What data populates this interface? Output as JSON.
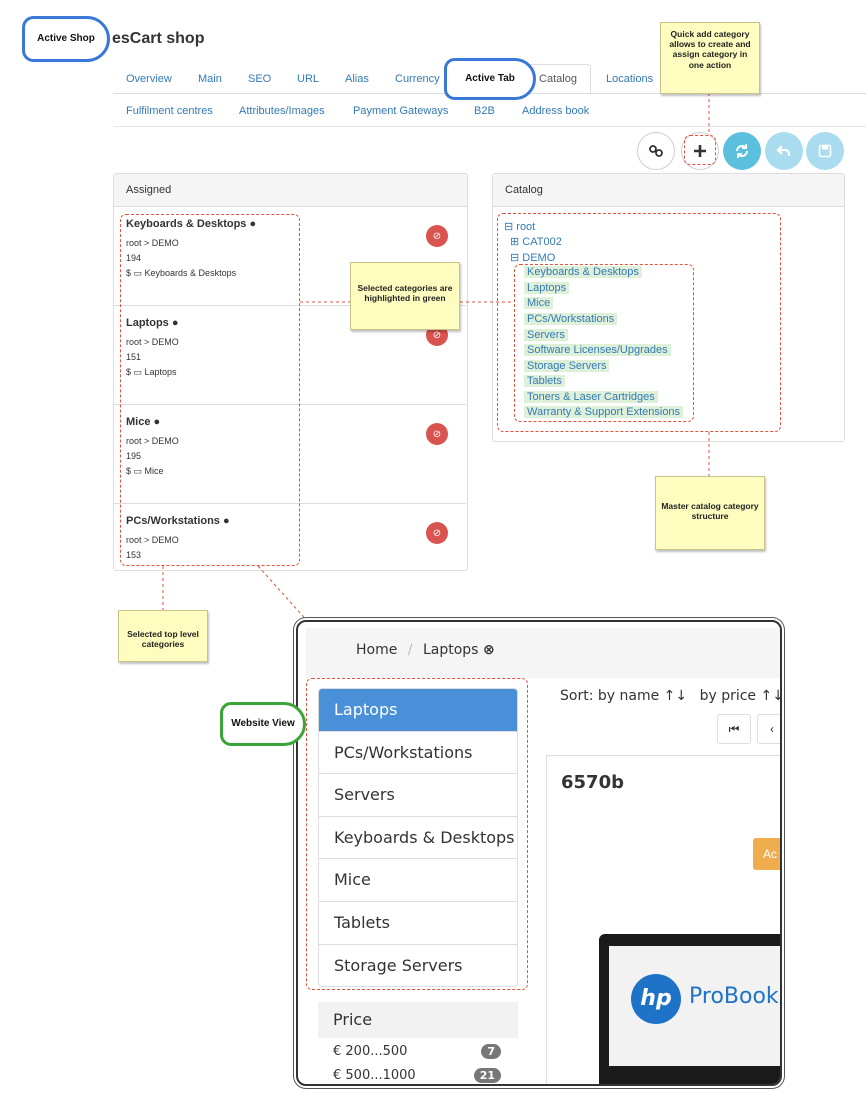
{
  "header": {
    "shop_title": "esCart shop"
  },
  "tabs_row1": [
    "Overview",
    "Main",
    "SEO",
    "URL",
    "Alias",
    "Currency",
    "Catalog",
    "Locations"
  ],
  "tabs_row2": [
    "Fulfilment centres",
    "Attributes/Images",
    "Payment Gateways",
    "B2B",
    "Address book"
  ],
  "toolbar": {
    "link_icon": "link-icon",
    "add_icon": "plus-icon",
    "refresh_icon": "refresh-icon",
    "undo_icon": "undo-icon",
    "save_icon": "save-icon"
  },
  "assigned": {
    "title": "Assigned",
    "items": [
      {
        "name": "Keyboards & Desktops",
        "path": "root > DEMO",
        "id": "194",
        "label": "Keyboards & Desktops"
      },
      {
        "name": "Laptops",
        "path": "root > DEMO",
        "id": "151",
        "label": "Laptops"
      },
      {
        "name": "Mice",
        "path": "root > DEMO",
        "id": "195",
        "label": "Mice"
      },
      {
        "name": "PCs/Workstations",
        "path": "root > DEMO",
        "id": "153",
        "label": ""
      }
    ]
  },
  "catalog": {
    "title": "Catalog",
    "root": "root",
    "cat002": "CAT002",
    "demo": "DEMO",
    "children": [
      "Keyboards & Desktops",
      "Laptops",
      "Mice",
      "PCs/Workstations",
      "Servers",
      "Software Licenses/Upgrades",
      "Storage Servers",
      "Tablets",
      "Toners & Laser Cartridges",
      "Warranty & Support Extensions"
    ]
  },
  "callouts": {
    "active_shop": "Active Shop",
    "active_tab": "Active Tab",
    "quick_add": "Quick add category allows to create and assign category in one action",
    "selected_highlight": "Selected categories are highlighted in green",
    "master_catalog": "Master catalog category structure",
    "selected_top": "Selected top level categories",
    "website_view": "Website View"
  },
  "website": {
    "breadcrumb_home": "Home",
    "breadcrumb_sep": "/",
    "breadcrumb_current": "Laptops",
    "categories": [
      "Laptops",
      "PCs/Workstations",
      "Servers",
      "Keyboards & Desktops",
      "Mice",
      "Tablets",
      "Storage Servers"
    ],
    "sort_label": "Sort: by name",
    "sort_price": "by price",
    "product_name": "6570b",
    "add_btn": "Ac",
    "brand_logo": "hp",
    "brand_text": "ProBook",
    "price_title": "Price",
    "price_ranges": [
      {
        "label": "€ 200...500",
        "count": "7"
      },
      {
        "label": "€ 500...1000",
        "count": "21"
      }
    ]
  },
  "colors": {
    "link": "#337ab7",
    "highlight": "#dff0d8",
    "active": "#4a90d9",
    "delete": "#d9534f",
    "teal": "#5bc0de",
    "note": "#fefdbf",
    "bubble_blue": "#3a78d8",
    "bubble_green": "#3aa33a"
  }
}
